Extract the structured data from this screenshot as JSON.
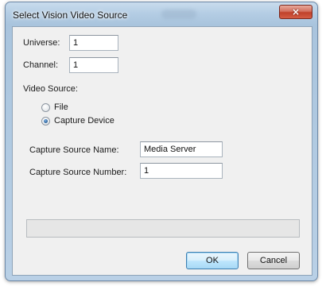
{
  "window": {
    "title": "Select Vision Video Source",
    "close_glyph": "×"
  },
  "form": {
    "universe_label": "Universe:",
    "universe_value": "1",
    "channel_label": "Channel:",
    "channel_value": "1",
    "video_source_label": "Video Source:",
    "video_source_options": [
      {
        "label": "File",
        "selected": false
      },
      {
        "label": "Capture Device",
        "selected": true
      }
    ],
    "capture_source_name_label": "Capture Source Name:",
    "capture_source_name_value": "Media Server",
    "capture_source_number_label": "Capture Source Number:",
    "capture_source_number_value": "1"
  },
  "buttons": {
    "ok_label": "OK",
    "cancel_label": "Cancel"
  },
  "icons": {
    "close": "close-icon",
    "radio_unselected": "radio-unselected-icon",
    "radio_selected": "radio-selected-icon"
  },
  "colors": {
    "title_bar": "#b4cde4",
    "client_background": "#f0f0f0",
    "close_button": "#c0412b",
    "default_button_border": "#3c7fb1"
  }
}
